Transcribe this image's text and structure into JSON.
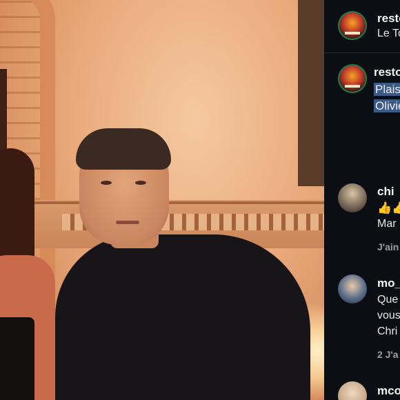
{
  "post_header": {
    "username": "resto",
    "location": "Le To"
  },
  "caption": {
    "username": "resto",
    "line1": "Plais",
    "line2": "Olivie"
  },
  "comments": [
    {
      "username": "chi",
      "emoji": "👍👍",
      "text": "Mar",
      "meta": "J'ain"
    },
    {
      "username": "mo_",
      "lines": [
        "Que",
        "vous",
        "Chri"
      ],
      "meta": "2 J'a"
    },
    {
      "username": "mco"
    }
  ],
  "colors": {
    "panel_bg": "#0b0f14",
    "selection_highlight": "#3b5a86",
    "avatar_ring": "#1c7c4f"
  }
}
